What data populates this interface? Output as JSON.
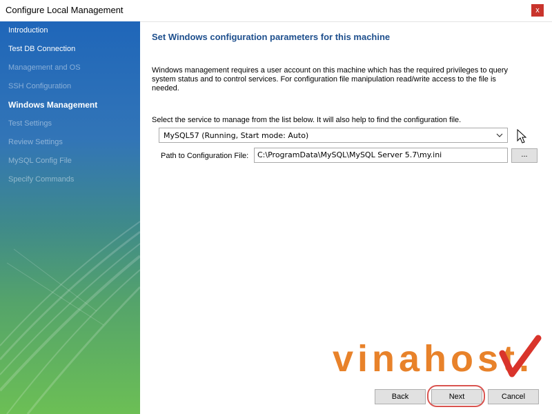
{
  "window": {
    "title": "Configure Local Management",
    "close_label": "x"
  },
  "sidebar": {
    "items": [
      {
        "label": "Introduction",
        "state": "done"
      },
      {
        "label": "Test DB Connection",
        "state": "done"
      },
      {
        "label": "Management and OS",
        "state": "pending"
      },
      {
        "label": "SSH Configuration",
        "state": "pending"
      },
      {
        "label": "Windows Management",
        "state": "active"
      },
      {
        "label": "Test Settings",
        "state": "pending"
      },
      {
        "label": "Review Settings",
        "state": "pending"
      },
      {
        "label": "MySQL Config File",
        "state": "pending"
      },
      {
        "label": "Specify Commands",
        "state": "pending"
      }
    ]
  },
  "main": {
    "heading": "Set Windows configuration parameters for this machine",
    "description": "Windows management requires a user account on this machine which has the required privileges to query system status and to control services. For configuration file manipulation read/write access to the file is needed.",
    "select_label": "Select the service to manage from the list below. It will also help to find the configuration file.",
    "service_value": "MySQL57 (Running, Start mode: Auto)",
    "path_label": "Path to Configuration File:",
    "path_value": "C:\\ProgramData\\MySQL\\MySQL Server 5.7\\my.ini",
    "browse_label": "..."
  },
  "footer": {
    "back_label": "Back",
    "next_label": "Next",
    "cancel_label": "Cancel"
  },
  "watermark": {
    "text": "vinahost.",
    "text_color": "#e8822a",
    "check_color": "#d9342b"
  },
  "colors": {
    "heading": "#1e4f8d",
    "highlight": "#d9534f"
  }
}
